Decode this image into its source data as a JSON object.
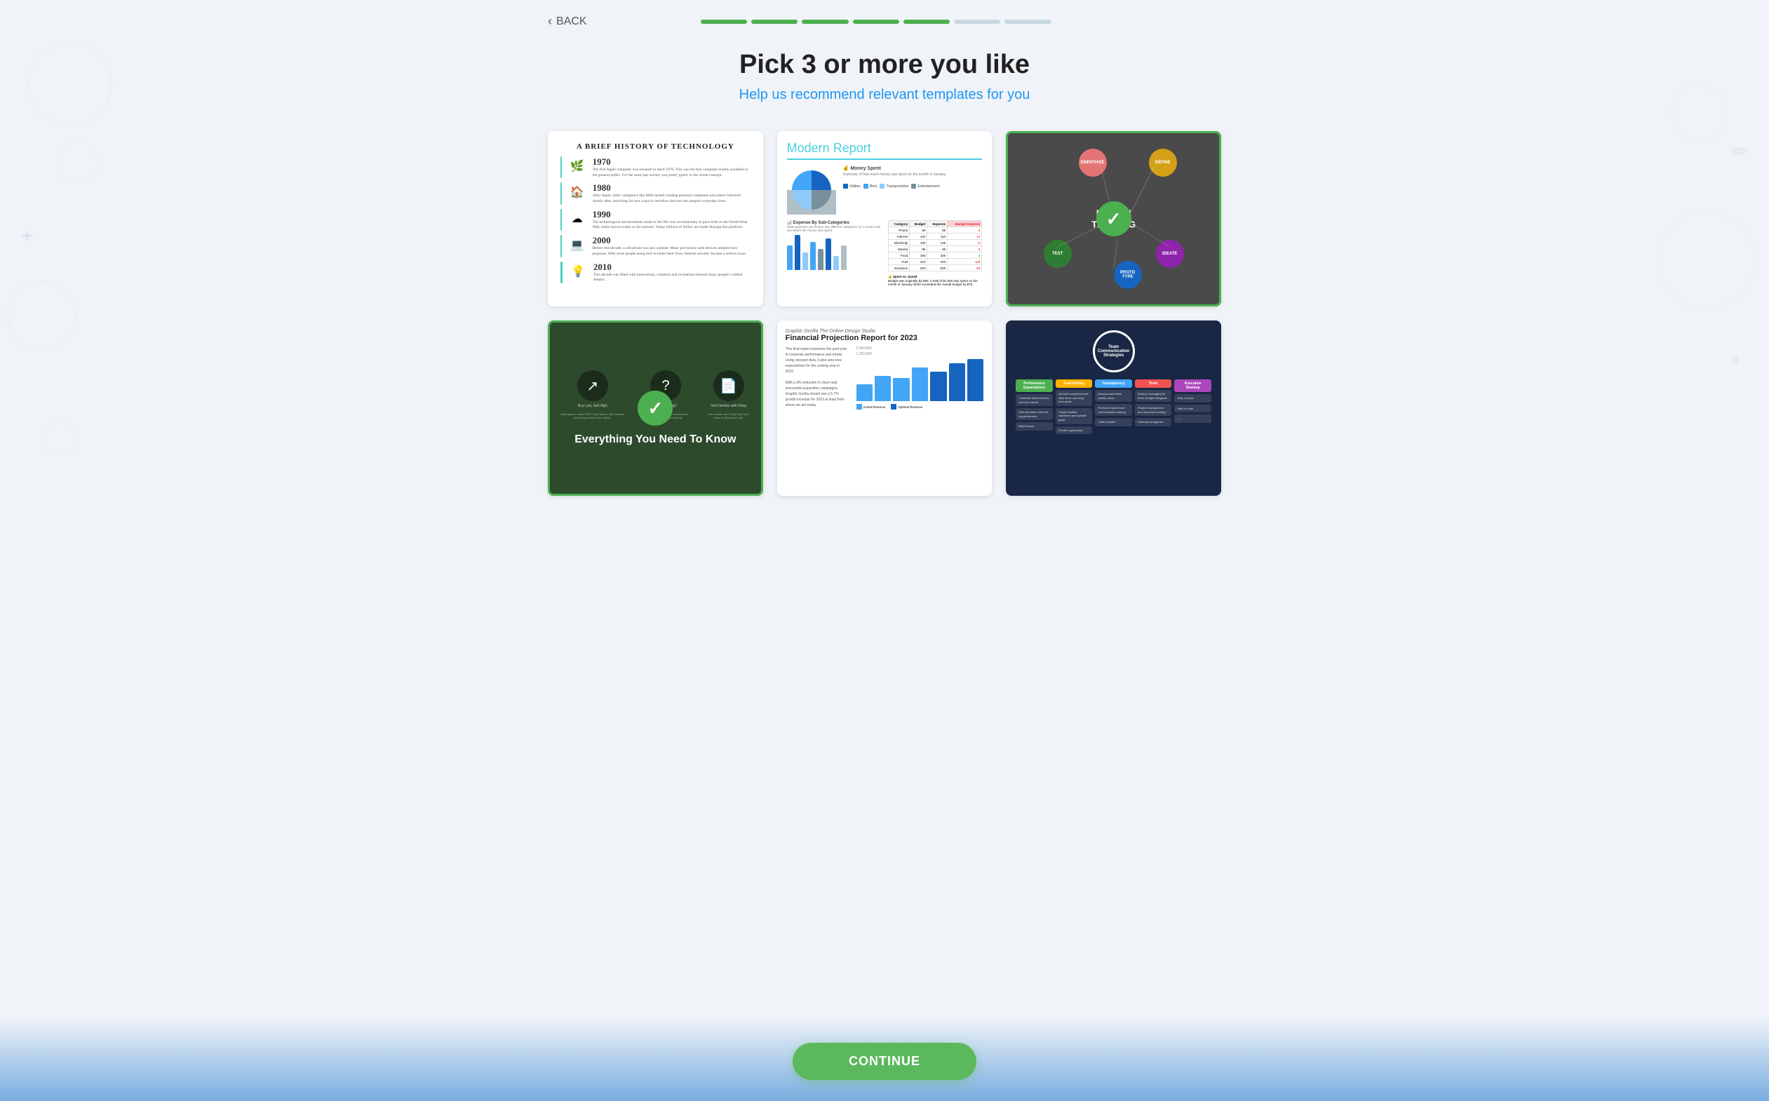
{
  "header": {
    "back_label": "BACK",
    "progress_segments": [
      {
        "filled": true
      },
      {
        "filled": true
      },
      {
        "filled": true
      },
      {
        "filled": true
      },
      {
        "filled": true
      },
      {
        "filled": false
      },
      {
        "filled": false
      }
    ]
  },
  "title": {
    "heading": "Pick 3 or more you like",
    "subheading": "Help us recommend relevant templates for you"
  },
  "templates": [
    {
      "id": "history",
      "name": "A Brief History of Technology",
      "selected": false,
      "type": "infographic-light"
    },
    {
      "id": "modern-report",
      "name": "Modern Report",
      "selected": false,
      "type": "report"
    },
    {
      "id": "design-thinking",
      "name": "Design Thinking",
      "selected": true,
      "type": "dark-diagram"
    },
    {
      "id": "dark-guide",
      "name": "Everything You Need To Know",
      "selected": true,
      "type": "dark-green"
    },
    {
      "id": "financial",
      "name": "Financial Projection Report for 2023",
      "selected": false,
      "type": "report"
    },
    {
      "id": "team-comm",
      "name": "Team Communication Strategies",
      "selected": false,
      "type": "dark-blue"
    }
  ],
  "continue_button": {
    "label": "CONTINUE"
  },
  "colors": {
    "accent_blue": "#2196f3",
    "accent_green": "#5cb85c",
    "teal": "#4dd0c4",
    "dark_bg": "#4a4a4a",
    "dark_green_bg": "#2d4a2d",
    "dark_navy": "#1a2744"
  }
}
